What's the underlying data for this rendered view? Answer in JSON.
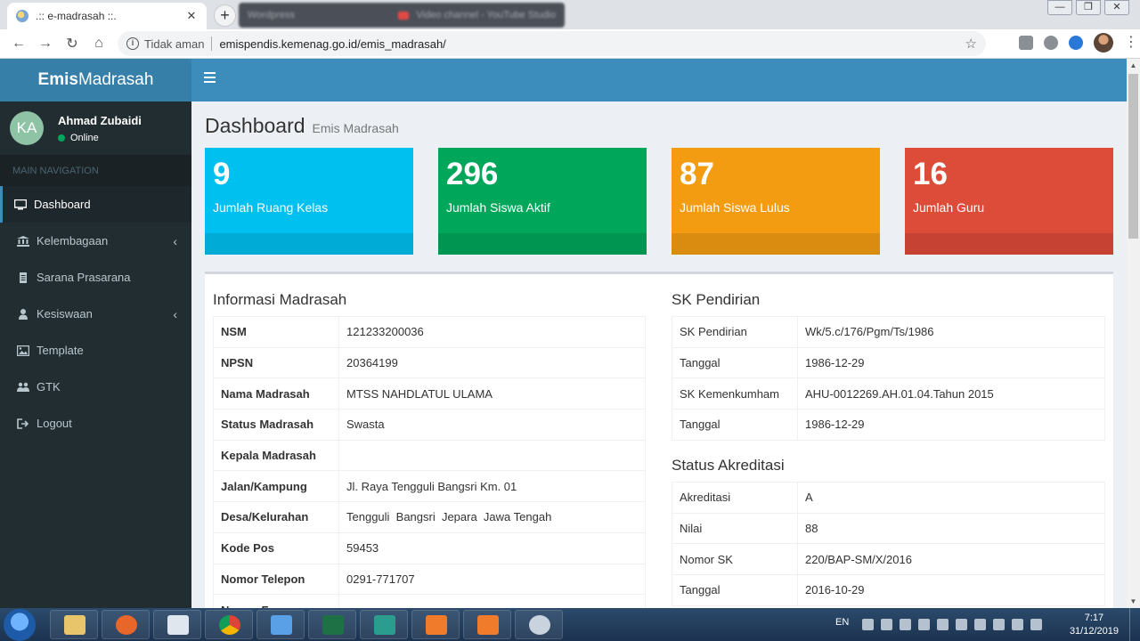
{
  "browser": {
    "tab_title": ".:: e-madrasah ::.",
    "tab_close": "✕",
    "new_tab": "+",
    "ghost_tab_1": "Wordpress",
    "ghost_tab_2": "Video channel - YouTube Studio",
    "minimize": "—",
    "maximize": "❐",
    "close": "✕",
    "back": "←",
    "forward": "→",
    "reload": "↻",
    "home": "⌂",
    "security_label": "Tidak aman",
    "url": "emispendis.kemenag.go.id/emis_madrasah/",
    "bookmark": "☆"
  },
  "app": {
    "logo_bold": "Emis",
    "logo_regular": "Madrasah",
    "user_initials": "KA",
    "user_name": "Ahmad Zubaidi",
    "user_status": "Online",
    "nav_header": "MAIN NAVIGATION",
    "menu": [
      {
        "label": "Dashboard",
        "icon": "monitor-icon"
      },
      {
        "label": "Kelembagaan",
        "icon": "bank-icon",
        "chevron": "‹"
      },
      {
        "label": "Sarana Prasarana",
        "icon": "file-icon"
      },
      {
        "label": "Kesiswaan",
        "icon": "user-icon",
        "chevron": "‹"
      },
      {
        "label": "Template",
        "icon": "image-icon"
      },
      {
        "label": "GTK",
        "icon": "users-icon"
      },
      {
        "label": "Logout",
        "icon": "sign-out-icon"
      }
    ]
  },
  "page": {
    "title": "Dashboard",
    "subtitle": "Emis Madrasah"
  },
  "stats": [
    {
      "value": "9",
      "label": "Jumlah Ruang Kelas",
      "color": "#00c0ef"
    },
    {
      "value": "296",
      "label": "Jumlah Siswa Aktif",
      "color": "#00a65a"
    },
    {
      "value": "87",
      "label": "Jumlah Siswa Lulus",
      "color": "#f39c12"
    },
    {
      "value": "16",
      "label": "Jumlah Guru",
      "color": "#dd4b39"
    }
  ],
  "info_madrasah": {
    "title": "Informasi Madrasah",
    "rows": [
      {
        "key": "NSM",
        "value": "121233200036"
      },
      {
        "key": "NPSN",
        "value": "20364199"
      },
      {
        "key": "Nama Madrasah",
        "value": "MTSS NAHDLATUL ULAMA"
      },
      {
        "key": "Status Madrasah",
        "value": "Swasta"
      },
      {
        "key": "Kepala Madrasah",
        "value": ""
      },
      {
        "key": "Jalan/Kampung",
        "value": "Jl. Raya Tengguli Bangsri Km. 01"
      },
      {
        "key": "Desa/Kelurahan",
        "value": "Tengguli  Bangsri  Jepara  Jawa Tengah"
      },
      {
        "key": "Kode Pos",
        "value": "59453"
      },
      {
        "key": "Nomor Telepon",
        "value": "0291-771707"
      },
      {
        "key": "Nomor Fax",
        "value": ""
      }
    ]
  },
  "sk_pendirian": {
    "title": "SK Pendirian",
    "rows": [
      {
        "key": "SK Pendirian",
        "value": "Wk/5.c/176/Pgm/Ts/1986"
      },
      {
        "key": "Tanggal",
        "value": "1986-12-29"
      },
      {
        "key": "SK Kemenkumham",
        "value": "AHU-0012269.AH.01.04.Tahun 2015"
      },
      {
        "key": "Tanggal",
        "value": "1986-12-29"
      }
    ]
  },
  "akreditasi": {
    "title": "Status Akreditasi",
    "rows": [
      {
        "key": "Akreditasi",
        "value": "A"
      },
      {
        "key": "Nilai",
        "value": "88"
      },
      {
        "key": "Nomor SK",
        "value": "220/BAP-SM/X/2016"
      },
      {
        "key": "Tanggal",
        "value": "2016-10-29"
      }
    ]
  },
  "taskbar": {
    "lang": "EN",
    "time": "7:17",
    "date": "31/12/2019"
  },
  "colors": {
    "header": "#3c8dbc",
    "logo_bg": "#367fa9",
    "sidebar": "#222d32"
  }
}
